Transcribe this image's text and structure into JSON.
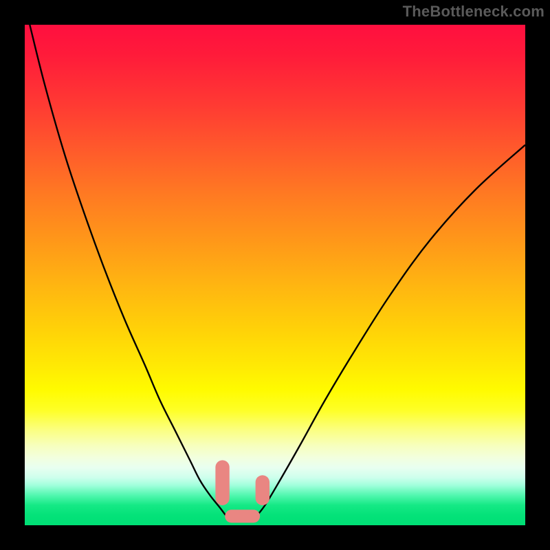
{
  "watermark": "TheBottleneck.com",
  "chart_data": {
    "type": "line",
    "title": "",
    "xlabel": "",
    "ylabel": "",
    "xlim": [
      0,
      100
    ],
    "ylim": [
      0,
      100
    ],
    "series": [
      {
        "name": "left-curve",
        "x": [
          1,
          4,
          8,
          12,
          16,
          20,
          24,
          27,
          30,
          33,
          35,
          37,
          39,
          40.5
        ],
        "y": [
          100,
          88,
          74,
          62,
          51,
          41,
          32,
          25,
          19,
          13,
          9,
          6,
          3.5,
          1.5
        ]
      },
      {
        "name": "right-curve",
        "x": [
          46,
          48,
          51,
          55,
          60,
          66,
          73,
          81,
          90,
          100
        ],
        "y": [
          1.5,
          4,
          9,
          16,
          25,
          35,
          46,
          57,
          67,
          76
        ]
      },
      {
        "name": "trough",
        "x": [
          40.5,
          42,
          44,
          46
        ],
        "y": [
          1.5,
          1.2,
          1.2,
          1.5
        ]
      }
    ],
    "annotations": {
      "floor_band_y": 3.5,
      "left_lozenge": {
        "x": 39.5,
        "y_top": 13,
        "y_bottom": 4,
        "width": 2.8
      },
      "right_lozenge": {
        "x": 47.5,
        "y_top": 10,
        "y_bottom": 4,
        "width": 2.8
      },
      "trough_band": {
        "x_left": 40.0,
        "x_right": 47.0,
        "y": 1.8,
        "height": 2.6
      }
    },
    "gradient_legend": {
      "top_color": "#ff0f3f",
      "mid_color": "#fffb00",
      "bottom_color": "#00df75"
    }
  }
}
